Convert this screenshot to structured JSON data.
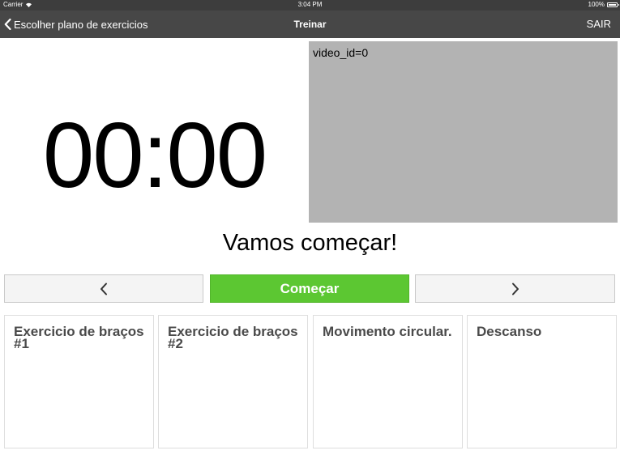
{
  "status_bar": {
    "carrier": "Carrier",
    "time": "3:04 PM",
    "battery": "100%"
  },
  "nav": {
    "back_label": "Escolher plano de exercicios",
    "title": "Treinar",
    "exit_label": "SAIR"
  },
  "timer": {
    "value": "00:00"
  },
  "video": {
    "label": "video_id=0"
  },
  "message": "Vamos começar!",
  "controls": {
    "prev_icon": "chevron-left-icon",
    "start_label": "Começar",
    "next_icon": "chevron-right-icon",
    "start_color": "#5cc732"
  },
  "exercises": [
    {
      "label": "Exercicio de braços #1"
    },
    {
      "label": "Exercicio de braços #2"
    },
    {
      "label": "Movimento circular."
    },
    {
      "label": "Descanso"
    }
  ]
}
